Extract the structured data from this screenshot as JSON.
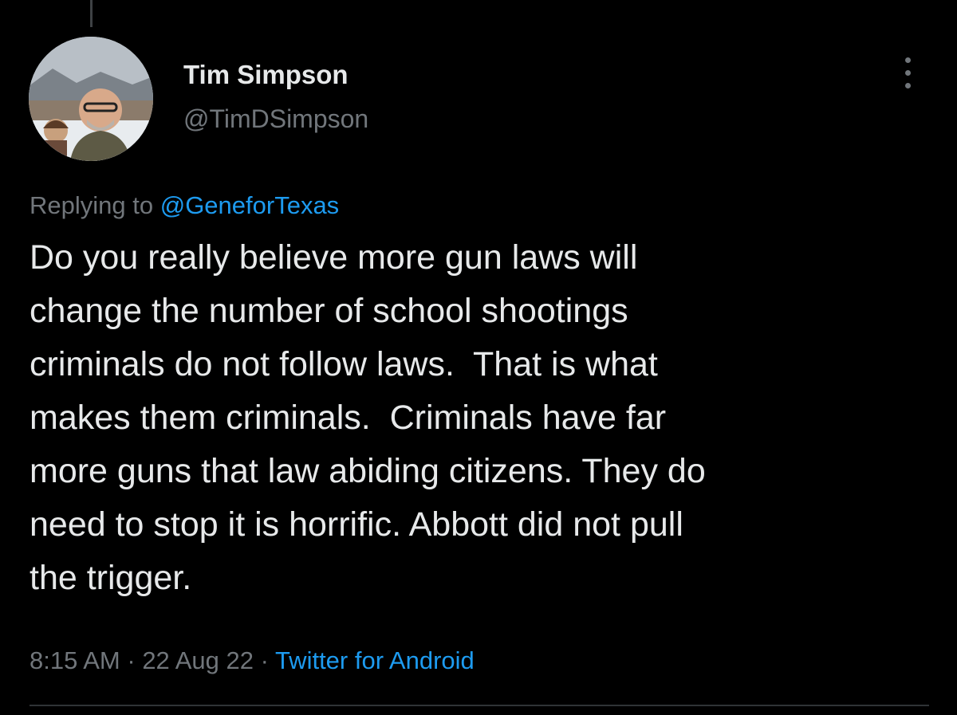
{
  "tweet": {
    "author": {
      "display_name": "Tim Simpson",
      "handle": "@TimDSimpson"
    },
    "reply_context": {
      "prefix": "Replying to ",
      "to_handle": "@GeneforTexas"
    },
    "text_lines": [
      "Do you really believe more gun laws will",
      "change the number of school shootings",
      "criminals do not follow laws.  That is what",
      "makes them criminals.  Criminals have far",
      "more guns that law abiding citizens. They do",
      "need to stop it is horrific. Abbott did not pull",
      "the trigger."
    ],
    "time": "8:15 AM",
    "separator": " · ",
    "date": "22 Aug 22",
    "source": "Twitter for Android"
  },
  "icons": {
    "more": "more-options-icon",
    "avatar": "avatar-photo"
  },
  "colors": {
    "background": "#000000",
    "primary_text": "#e7e9ea",
    "secondary_text": "#71767b",
    "accent": "#1d9bf0",
    "divider": "#2f3336"
  }
}
